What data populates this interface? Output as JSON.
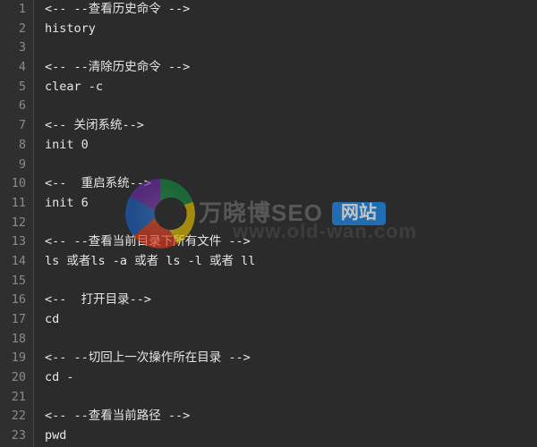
{
  "editor": {
    "lines": [
      {
        "num": 1,
        "text": "<-- --查看历史命令 -->"
      },
      {
        "num": 2,
        "text": "history"
      },
      {
        "num": 3,
        "text": ""
      },
      {
        "num": 4,
        "text": "<-- --清除历史命令 -->"
      },
      {
        "num": 5,
        "text": "clear -c"
      },
      {
        "num": 6,
        "text": ""
      },
      {
        "num": 7,
        "text": "<-- 关闭系统-->"
      },
      {
        "num": 8,
        "text": "init 0"
      },
      {
        "num": 9,
        "text": ""
      },
      {
        "num": 10,
        "text": "<--  重启系统-->"
      },
      {
        "num": 11,
        "text": "init 6"
      },
      {
        "num": 12,
        "text": ""
      },
      {
        "num": 13,
        "text": "<-- --查看当前目录下所有文件 -->"
      },
      {
        "num": 14,
        "text": "ls 或者ls -a 或者 ls -l 或者 ll"
      },
      {
        "num": 15,
        "text": ""
      },
      {
        "num": 16,
        "text": "<--  打开目录-->"
      },
      {
        "num": 17,
        "text": "cd"
      },
      {
        "num": 18,
        "text": ""
      },
      {
        "num": 19,
        "text": "<-- --切回上一次操作所在目录 -->"
      },
      {
        "num": 20,
        "text": "cd -"
      },
      {
        "num": 21,
        "text": ""
      },
      {
        "num": 22,
        "text": "<-- --查看当前路径 -->"
      },
      {
        "num": 23,
        "text": "pwd"
      }
    ]
  },
  "watermark": {
    "brand_text": "万晓博SEO",
    "badge_text": "网站",
    "url_text": "www.old-wan.com"
  }
}
